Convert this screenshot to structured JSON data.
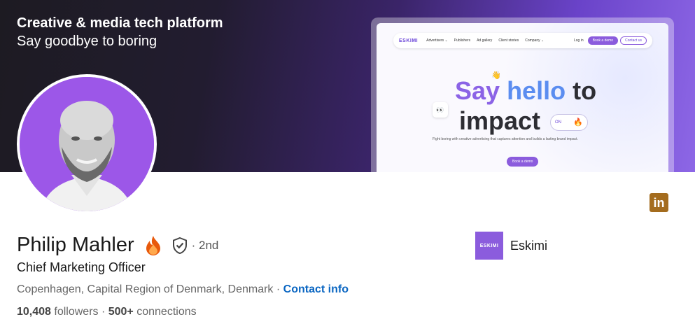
{
  "banner": {
    "title": "Creative & media tech platform",
    "subtitle": "Say goodbye to boring",
    "mockup": {
      "logo": "ESKIMI",
      "nav_links": [
        "Advertisers ⌄",
        "Publishers",
        "Ad gallery",
        "Client stories",
        "Company ⌄"
      ],
      "login": "Log in",
      "book_demo": "Book a demo",
      "contact_us": "Contact us",
      "hero_say": "Say ",
      "hero_hello": "hello",
      "hero_to": " to",
      "hero_impact": "impact",
      "toggle_label": "ON",
      "tagline": "Fight boring with creative advertising that captures attention and builds a lasting brand impact.",
      "cta": "Book a demo"
    }
  },
  "profile": {
    "name": "Philip Mahler",
    "degree": "· 2nd",
    "headline": "Chief Marketing Officer",
    "location": "Copenhagen, Capital Region of Denmark, Denmark",
    "location_sep": " · ",
    "contact_info": "Contact info",
    "followers_count": "10,408",
    "followers_label": " followers",
    "stats_sep": " · ",
    "connections_count": "500+",
    "connections_label": " connections"
  },
  "company": {
    "logo_text": "ESKIMI",
    "name": "Eskimi"
  },
  "badge": {
    "text": "in"
  },
  "colors": {
    "link": "#0a66c2",
    "eskimi_purple": "#8b5cdd",
    "linkedin_gold": "#a46c1e"
  },
  "icons": [
    "fire-icon",
    "verified-shield-icon",
    "linkedin-icon",
    "wave-hand-icon",
    "eyes-icon",
    "fire-toggle-icon"
  ]
}
